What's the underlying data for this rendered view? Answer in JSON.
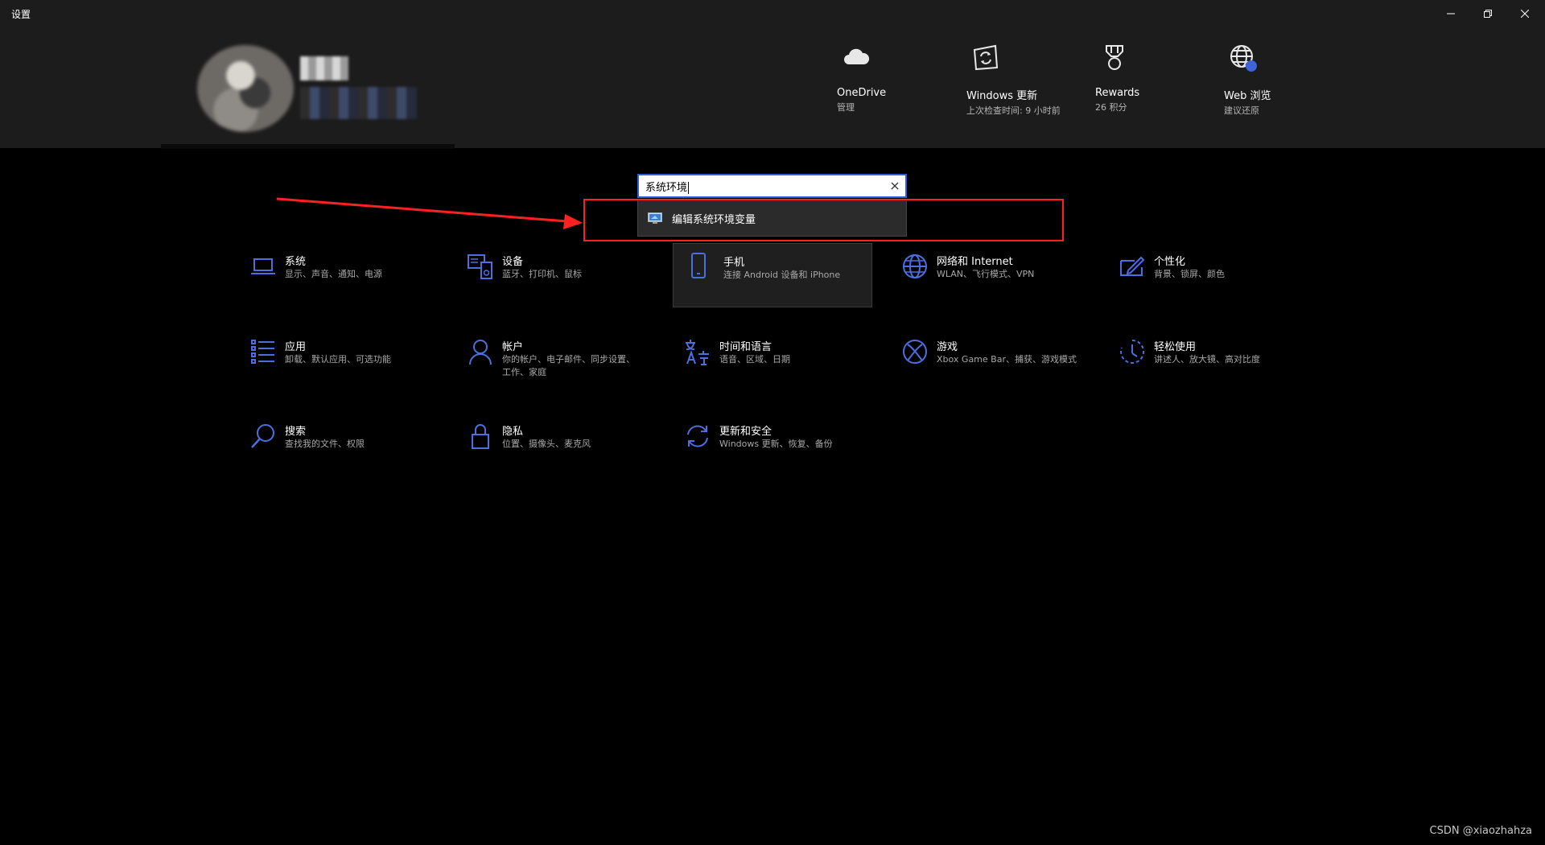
{
  "window": {
    "title": "设置",
    "minimize": "minimize",
    "restore": "restore",
    "close": "close"
  },
  "header": {
    "quick_links": [
      {
        "icon": "cloud-icon",
        "title": "OneDrive",
        "subtitle": "管理"
      },
      {
        "icon": "windows-update-icon",
        "title": "Windows 更新",
        "subtitle": "上次检查时间: 9 小时前"
      },
      {
        "icon": "rewards-icon",
        "title": "Rewards",
        "subtitle": "26 积分"
      },
      {
        "icon": "web-browsing-icon",
        "title": "Web 浏览",
        "subtitle": "建议还原"
      }
    ]
  },
  "search": {
    "value": "系统环境",
    "suggestion": "编辑系统环境变量"
  },
  "categories": [
    {
      "icon": "laptop-icon",
      "title": "系统",
      "subtitle": "显示、声音、通知、电源"
    },
    {
      "icon": "devices-icon",
      "title": "设备",
      "subtitle": "蓝牙、打印机、鼠标"
    },
    {
      "icon": "phone-icon",
      "title": "手机",
      "subtitle": "连接 Android 设备和 iPhone"
    },
    {
      "icon": "globe-icon",
      "title": "网络和 Internet",
      "subtitle": "WLAN、飞行模式、VPN"
    },
    {
      "icon": "personalization-icon",
      "title": "个性化",
      "subtitle": "背景、锁屏、颜色"
    },
    {
      "icon": "apps-list-icon",
      "title": "应用",
      "subtitle": "卸载、默认应用、可选功能"
    },
    {
      "icon": "person-icon",
      "title": "帐户",
      "subtitle": "你的帐户、电子邮件、同步设置、工作、家庭"
    },
    {
      "icon": "language-icon",
      "title": "时间和语言",
      "subtitle": "语音、区域、日期"
    },
    {
      "icon": "xbox-icon",
      "title": "游戏",
      "subtitle": "Xbox Game Bar、捕获、游戏模式"
    },
    {
      "icon": "ease-of-access-icon",
      "title": "轻松使用",
      "subtitle": "讲述人、放大镜、高对比度"
    },
    {
      "icon": "search-icon",
      "title": "搜索",
      "subtitle": "查找我的文件、权限"
    },
    {
      "icon": "lock-icon",
      "title": "隐私",
      "subtitle": "位置、摄像头、麦克风"
    },
    {
      "icon": "sync-icon",
      "title": "更新和安全",
      "subtitle": "Windows 更新、恢复、备份"
    }
  ],
  "accent_color": "#4c6fe0",
  "watermark": "CSDN @xiaozhahza"
}
